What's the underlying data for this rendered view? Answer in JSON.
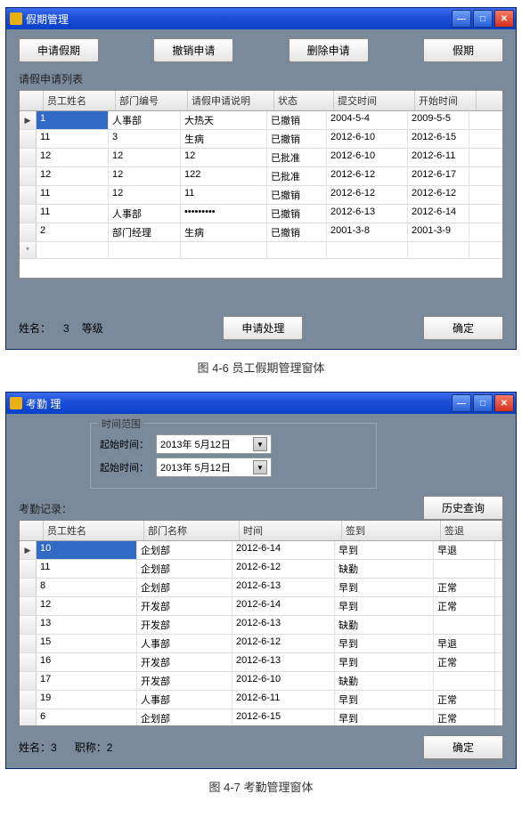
{
  "win1": {
    "title": "假期管理",
    "buttons": [
      "申请假期",
      "撤销申请",
      "删除申请",
      "假期"
    ],
    "listLabel": "请假申请列表",
    "cols": [
      "员工姓名",
      "部门编号",
      "请假申请说明",
      "状态",
      "提交时间",
      "开始时间"
    ],
    "rows": [
      [
        "1",
        "人事部",
        "大热天",
        "已撤销",
        "2004-5-4",
        "2009-5-5"
      ],
      [
        "11",
        "3",
        "生病",
        "已撤销",
        "2012-6-10",
        "2012-6-15"
      ],
      [
        "12",
        "12",
        "12",
        "已批准",
        "2012-6-10",
        "2012-6-11"
      ],
      [
        "12",
        "12",
        "122",
        "已批准",
        "2012-6-12",
        "2012-6-17"
      ],
      [
        "11",
        "12",
        "11",
        "已撤销",
        "2012-6-12",
        "2012-6-12"
      ],
      [
        "11",
        "人事部",
        "•••••••••",
        "已撤销",
        "2012-6-13",
        "2012-6-14"
      ],
      [
        "2",
        "部门经理",
        "生病",
        "已撤销",
        "2001-3-8",
        "2001-3-9"
      ]
    ],
    "foot": {
      "name": "姓名：",
      "nameVal": "3",
      "grade": "等级",
      "processBtn": "申请处理",
      "okBtn": "确定"
    },
    "caption": "图 4-6 员工假期管理窗体"
  },
  "win2": {
    "title": "考勤   理",
    "timeBox": {
      "legend": "时间范围",
      "start": "起始时间：",
      "date": "2013年 5月12日"
    },
    "historyBtn": "历史查询",
    "listLabel": "考勤记录：",
    "cols": [
      "员工姓名",
      "部门名称",
      "时间",
      "签到",
      "签退"
    ],
    "rows": [
      [
        "10",
        "企划部",
        "2012-6-14",
        "早到",
        "早退"
      ],
      [
        "11",
        "企划部",
        "2012-6-12",
        "缺勤",
        ""
      ],
      [
        "8",
        "企划部",
        "2012-6-13",
        "早到",
        "正常"
      ],
      [
        "12",
        "开发部",
        "2012-6-14",
        "早到",
        "正常"
      ],
      [
        "13",
        "开发部",
        "2012-6-13",
        "缺勤",
        ""
      ],
      [
        "15",
        "人事部",
        "2012-6-12",
        "早到",
        "早退"
      ],
      [
        "16",
        "开发部",
        "2012-6-13",
        "早到",
        "正常"
      ],
      [
        "17",
        "开发部",
        "2012-6-10",
        "缺勤",
        ""
      ],
      [
        "19",
        "人事部",
        "2012-6-11",
        "早到",
        "正常"
      ],
      [
        "6",
        "企划部",
        "2012-6-15",
        "早到",
        "正常"
      ]
    ],
    "foot": {
      "name": "姓名：",
      "nameVal": "3",
      "rank": "职称：",
      "rankVal": "2",
      "okBtn": "确定"
    },
    "caption": "图 4-7 考勤管理窗体"
  }
}
